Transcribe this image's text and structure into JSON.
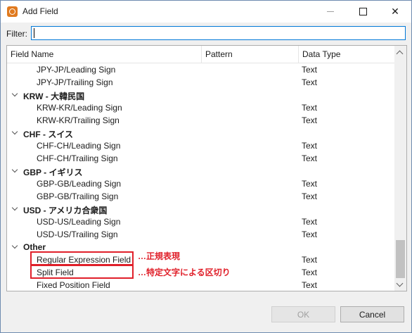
{
  "window": {
    "title": "Add Field",
    "controls": {
      "minimize": "─",
      "maximize": "□",
      "close": "✕"
    }
  },
  "filter": {
    "label": "Filter:",
    "value": ""
  },
  "columns": {
    "name": "Field Name",
    "pattern": "Pattern",
    "type": "Data Type"
  },
  "rows": [
    {
      "kind": "child",
      "name": "JPY-JP/Leading Sign",
      "type": "Text"
    },
    {
      "kind": "child",
      "name": "JPY-JP/Trailing Sign",
      "type": "Text"
    },
    {
      "kind": "group",
      "name": "KRW - 大韓民国",
      "type": ""
    },
    {
      "kind": "child",
      "name": "KRW-KR/Leading Sign",
      "type": "Text"
    },
    {
      "kind": "child",
      "name": "KRW-KR/Trailing Sign",
      "type": "Text"
    },
    {
      "kind": "group",
      "name": "CHF - スイス",
      "type": ""
    },
    {
      "kind": "child",
      "name": "CHF-CH/Leading Sign",
      "type": "Text"
    },
    {
      "kind": "child",
      "name": "CHF-CH/Trailing Sign",
      "type": "Text"
    },
    {
      "kind": "group",
      "name": "GBP - イギリス",
      "type": ""
    },
    {
      "kind": "child",
      "name": "GBP-GB/Leading Sign",
      "type": "Text"
    },
    {
      "kind": "child",
      "name": "GBP-GB/Trailing Sign",
      "type": "Text"
    },
    {
      "kind": "group",
      "name": "USD - アメリカ合衆国",
      "type": ""
    },
    {
      "kind": "child",
      "name": "USD-US/Leading Sign",
      "type": "Text"
    },
    {
      "kind": "child",
      "name": "USD-US/Trailing Sign",
      "type": "Text"
    },
    {
      "kind": "group",
      "name": "Other",
      "type": ""
    },
    {
      "kind": "child",
      "name": "Regular Expression Field",
      "type": "Text"
    },
    {
      "kind": "child",
      "name": "Split Field",
      "type": "Text"
    },
    {
      "kind": "child",
      "name": "Fixed Position Field",
      "type": "Text"
    }
  ],
  "annotations": {
    "regex": "…正規表現",
    "split": "…特定文字による区切り",
    "color": "#e0202a"
  },
  "buttons": {
    "ok": "OK",
    "cancel": "Cancel"
  },
  "icons": {
    "app": "app-logo-icon",
    "group_toggle": "chevron-down-icon"
  }
}
